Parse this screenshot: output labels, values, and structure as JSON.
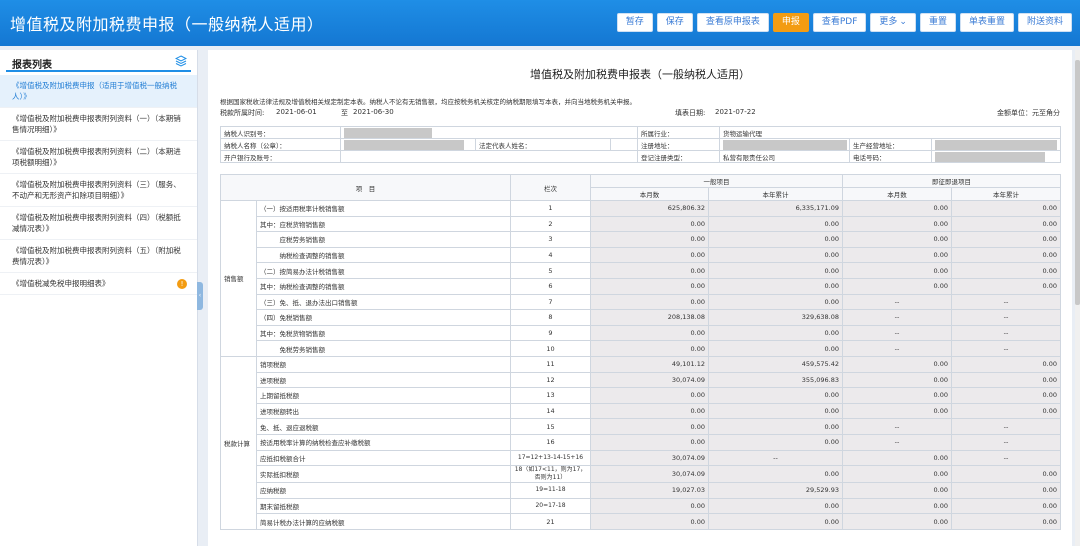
{
  "header": {
    "title": "增值税及附加税费申报（一般纳税人适用）",
    "buttons": [
      {
        "label": "暂存",
        "primary": false
      },
      {
        "label": "保存",
        "primary": false
      },
      {
        "label": "查看原申报表",
        "primary": false
      },
      {
        "label": "申报",
        "primary": true
      },
      {
        "label": "查看PDF",
        "primary": false
      },
      {
        "label": "更多",
        "primary": false,
        "caret": true
      },
      {
        "label": "重置",
        "primary": false
      },
      {
        "label": "单表重置",
        "primary": false
      },
      {
        "label": "附送资料",
        "primary": false
      }
    ]
  },
  "sidebar": {
    "title": "报表列表",
    "items": [
      {
        "label": "《增值税及附加税费申报（适用于增值税一般纳税人）》",
        "active": true
      },
      {
        "label": "《增值税及附加税费申报表附列资料（一）（本期销售情况明细）》",
        "active": false
      },
      {
        "label": "《增值税及附加税费申报表附列资料（二）（本期进项税额明细）》",
        "active": false
      },
      {
        "label": "《增值税及附加税费申报表附列资料（三）（服务、不动产和无形资产扣除项目明细）》",
        "active": false
      },
      {
        "label": "《增值税及附加税费申报表附列资料（四）（税额抵减情况表）》",
        "active": false
      },
      {
        "label": "《增值税及附加税费申报表附列资料（五）（附加税费情况表）》",
        "active": false
      },
      {
        "label": "《增值税减免税申报明细表》",
        "active": false,
        "badge": "!"
      }
    ]
  },
  "document": {
    "title": "增值税及附加税费申报表（一般纳税人适用）",
    "note": "根据国家税收法律法规及增值税相关规定制定本表。纳税人不论有无销售额，均应按税务机关核定的纳税期限填写本表，并向当地税务机关申报。",
    "period_label": "税款所属时间:",
    "period_from": "2021-06-01",
    "period_to_label": "至",
    "period_to": "2021-06-30",
    "fill_date_label": "填表日期:",
    "fill_date": "2021-07-22",
    "unit": "金额单位：元至角分",
    "info": {
      "taxpayer_id_label": "纳税人识别号：",
      "industry_label": "所属行业：",
      "industry": "货物运输代理",
      "name_label": "纳税人名称（公章）：",
      "legal_rep_label": "法定代表人姓名：",
      "reg_address_label": "注册地址：",
      "biz_address_label": "生产经营地址：",
      "bank_label": "开户银行及账号：",
      "reg_type_label": "登记注册类型：",
      "reg_type": "私营有限责任公司",
      "phone_label": "电话号码："
    },
    "columns": {
      "item": "项　目",
      "line": "栏次",
      "general": "一般项目",
      "immediate": "即征即退项目",
      "month": "本月数",
      "ytd": "本年累计"
    },
    "groups": [
      {
        "name": "销售额",
        "rows": [
          {
            "item": "（一）按适用税率计税销售额",
            "line": "1",
            "v": [
              "625,806.32",
              "6,335,171.09",
              "0.00",
              "0.00"
            ]
          },
          {
            "item": "其中：应税货物销售额",
            "line": "2",
            "v": [
              "0.00",
              "0.00",
              "0.00",
              "0.00"
            ]
          },
          {
            "item": "　　　应税劳务销售额",
            "line": "3",
            "v": [
              "0.00",
              "0.00",
              "0.00",
              "0.00"
            ]
          },
          {
            "item": "　　　纳税检查调整的销售额",
            "line": "4",
            "v": [
              "0.00",
              "0.00",
              "0.00",
              "0.00"
            ]
          },
          {
            "item": "（二）按简易办法计税销售额",
            "line": "5",
            "v": [
              "0.00",
              "0.00",
              "0.00",
              "0.00"
            ]
          },
          {
            "item": "其中：纳税检查调整的销售额",
            "line": "6",
            "v": [
              "0.00",
              "0.00",
              "0.00",
              "0.00"
            ]
          },
          {
            "item": "（三）免、抵、退办法出口销售额",
            "line": "7",
            "v": [
              "0.00",
              "0.00",
              "--",
              "--"
            ]
          },
          {
            "item": "（四）免税销售额",
            "line": "8",
            "v": [
              "208,138.08",
              "329,638.08",
              "--",
              "--"
            ]
          },
          {
            "item": "其中：免税货物销售额",
            "line": "9",
            "v": [
              "0.00",
              "0.00",
              "--",
              "--"
            ]
          },
          {
            "item": "　　　免税劳务销售额",
            "line": "10",
            "v": [
              "0.00",
              "0.00",
              "--",
              "--"
            ]
          }
        ]
      },
      {
        "name": "税款计算",
        "rows": [
          {
            "item": "销项税额",
            "line": "11",
            "v": [
              "49,101.12",
              "459,575.42",
              "0.00",
              "0.00"
            ]
          },
          {
            "item": "进项税额",
            "line": "12",
            "v": [
              "30,074.09",
              "355,096.83",
              "0.00",
              "0.00"
            ]
          },
          {
            "item": "上期留抵税额",
            "line": "13",
            "v": [
              "0.00",
              "0.00",
              "0.00",
              "0.00"
            ]
          },
          {
            "item": "进项税额转出",
            "line": "14",
            "v": [
              "0.00",
              "0.00",
              "0.00",
              "0.00"
            ]
          },
          {
            "item": "免、抵、退应退税额",
            "line": "15",
            "v": [
              "0.00",
              "0.00",
              "--",
              "--"
            ]
          },
          {
            "item": "按适用税率计算的纳税检查应补缴税额",
            "line": "16",
            "v": [
              "0.00",
              "0.00",
              "--",
              "--"
            ]
          },
          {
            "item": "应抵扣税额合计",
            "line": "17=12+13-14-15+16",
            "v": [
              "30,074.09",
              "--",
              "0.00",
              "--"
            ]
          },
          {
            "item": "实际抵扣税额",
            "line": "18（如17<11，则为17，否则为11）",
            "v": [
              "30,074.09",
              "0.00",
              "0.00",
              "0.00"
            ]
          },
          {
            "item": "应纳税额",
            "line": "19=11-18",
            "v": [
              "19,027.03",
              "29,529.93",
              "0.00",
              "0.00"
            ]
          },
          {
            "item": "期末留抵税额",
            "line": "20=17-18",
            "v": [
              "0.00",
              "0.00",
              "0.00",
              "0.00"
            ]
          },
          {
            "item": "简易计税办法计算的应纳税额",
            "line": "21",
            "v": [
              "0.00",
              "0.00",
              "0.00",
              "0.00"
            ]
          }
        ]
      }
    ]
  }
}
